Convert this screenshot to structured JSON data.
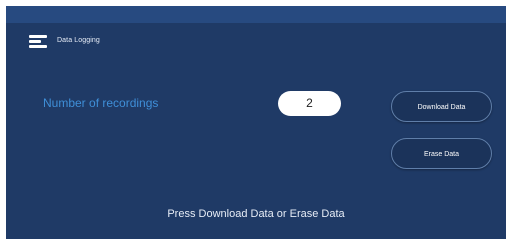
{
  "header": {
    "title": "Data Logging",
    "menu_icon": "hamburger-menu-icon"
  },
  "recordings": {
    "label": "Number of recordings",
    "value": "2"
  },
  "actions": {
    "download_label": "Download Data",
    "erase_label": "Erase Data"
  },
  "status": {
    "message": "Press Download Data or Erase Data"
  },
  "colors": {
    "background": "#1f3a66",
    "top_bar": "#274a80",
    "label_accent": "#3f8fd8",
    "button_fill": "#1b335a",
    "button_border": "#5f7ea9"
  }
}
